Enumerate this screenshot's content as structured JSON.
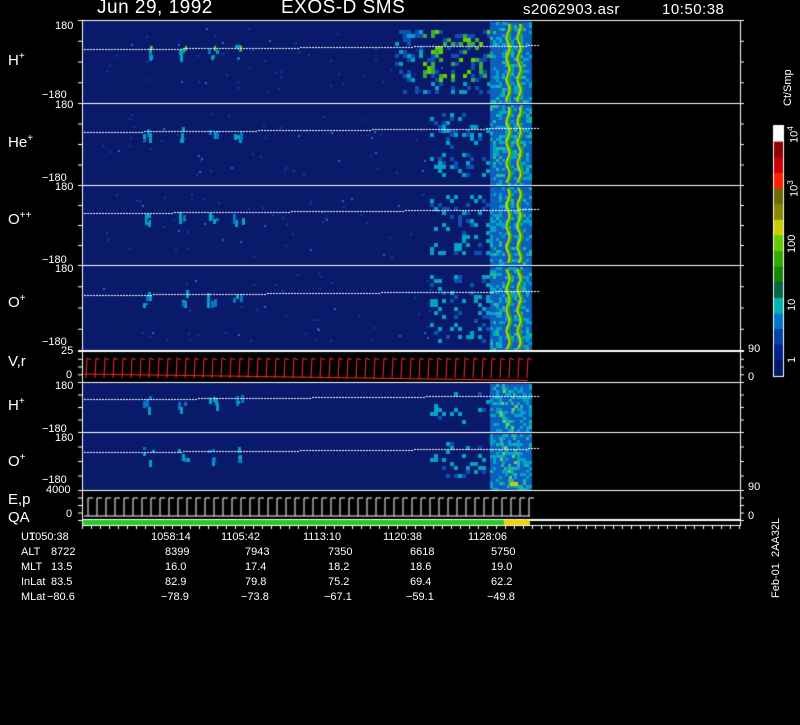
{
  "header": {
    "date": "Jun 29, 1992",
    "instrument": "EXOS-D SMS",
    "file": "s2062903.asr",
    "time": "10:50:38"
  },
  "panels": [
    {
      "id": "h",
      "label": "H",
      "sup": "+",
      "ymax": "180",
      "ymin": "−180"
    },
    {
      "id": "he",
      "label": "He",
      "sup": "+",
      "ymax": "180",
      "ymin": "−180"
    },
    {
      "id": "opp",
      "label": "O",
      "sup": "++",
      "ymax": "180",
      "ymin": "−180"
    },
    {
      "id": "o",
      "label": "O",
      "sup": "+",
      "ymax": "180",
      "ymin": "−180"
    },
    {
      "id": "vr",
      "label": "V,r",
      "sup": "",
      "ymax": "25",
      "ymin": "0",
      "rmax": "90",
      "rmin": "0"
    },
    {
      "id": "h2",
      "label": "H",
      "sup": "+",
      "ymax": "180",
      "ymin": "−180"
    },
    {
      "id": "o2",
      "label": "O",
      "sup": "+",
      "ymax": "180",
      "ymin": "−180"
    },
    {
      "id": "ep",
      "label": "E,p",
      "sup": "",
      "ymax": "4000",
      "ymin": "0",
      "rmax": "90",
      "rmin": "0"
    }
  ],
  "qa_label": "QA",
  "colorbar": {
    "title": "Ct/Smp",
    "ticks": [
      "10",
      "4",
      "10",
      "3",
      "100",
      "10",
      "1"
    ],
    "colors": [
      "#ffffff",
      "#8b0000",
      "#cc0000",
      "#ff2000",
      "#6b6b00",
      "#888800",
      "#cccc00",
      "#66cc00",
      "#33aa00",
      "#118800",
      "#006644",
      "#00b3b3",
      "#0077cc",
      "#0044aa",
      "#002288",
      "#001a66"
    ]
  },
  "footer_label": "Feb-01  2AA32L",
  "table": {
    "row_labels": [
      "UT",
      "ALT",
      "MLT",
      "InLat",
      "MLat"
    ],
    "columns": [
      [
        "1050:38",
        "8722",
        "13.5",
        "83.5",
        "−80.6"
      ],
      [
        "1058:14",
        "8399",
        "16.0",
        "82.9",
        "−78.9"
      ],
      [
        "1105:42",
        "7943",
        "17.4",
        "79.8",
        "−73.8"
      ],
      [
        "1113:10",
        "7350",
        "18.2",
        "75.2",
        "−67.1"
      ],
      [
        "1120:38",
        "6618",
        "18.6",
        "69.4",
        "−59.1"
      ],
      [
        "1128:06",
        "5750",
        "19.0",
        "62.2",
        "−49.8"
      ]
    ]
  },
  "chart_data": {
    "type": "heatmap",
    "title": "Jun 29, 1992   EXOS-D SMS",
    "x_label": "UT",
    "x_ticks": [
      "1050:38",
      "1058:14",
      "1105:42",
      "1113:10",
      "1120:38",
      "1128:06"
    ],
    "panels": [
      "H+",
      "He+",
      "O++",
      "O+",
      "V,r",
      "H+",
      "O+",
      "E,p",
      "QA"
    ],
    "y_range_pitch": [
      -180,
      180
    ],
    "y_range_V": [
      0,
      25
    ],
    "y_range_E": [
      0,
      4000
    ],
    "right_axis_r": [
      0,
      90
    ],
    "colorbar_unit": "Ct/Smp",
    "colorbar_range": [
      1,
      10000
    ],
    "colorbar_scale": "log",
    "data_ends_at_UT": "1130"
  }
}
